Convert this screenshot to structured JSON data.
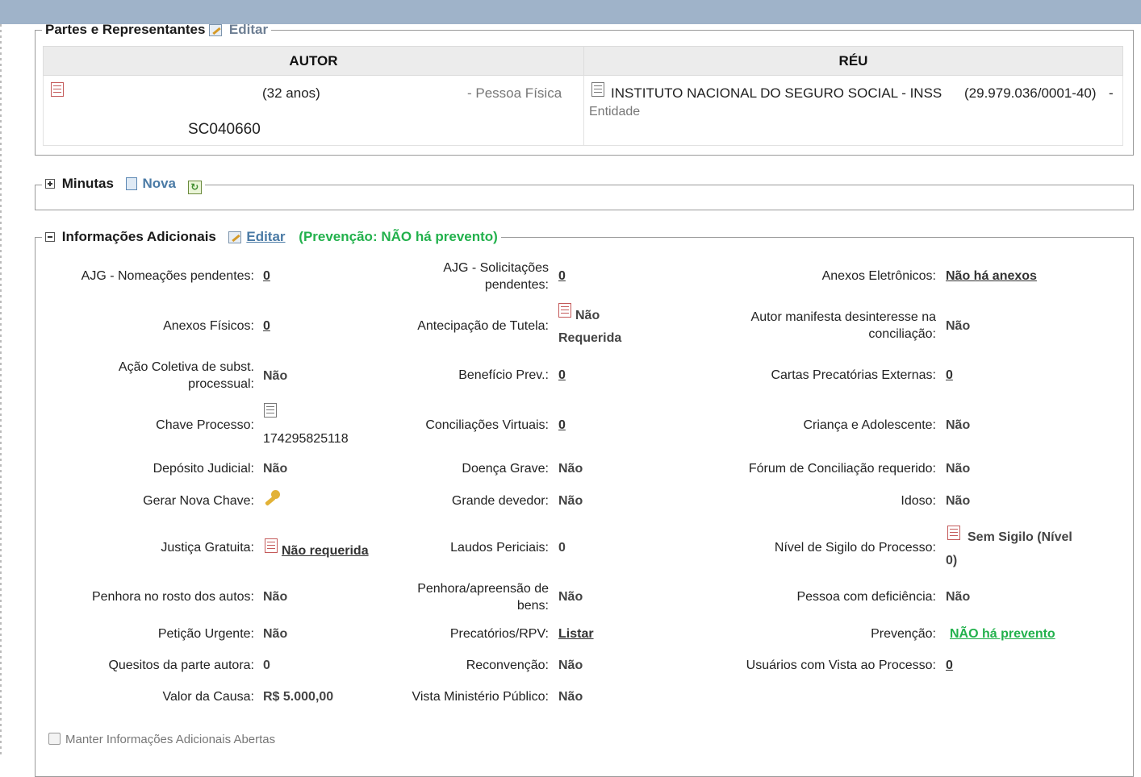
{
  "partes": {
    "legend": "Partes e Representantes",
    "edit_label": "Editar",
    "col_autor": "AUTOR",
    "col_reu": "RÉU",
    "autor": {
      "age": "(32 anos)",
      "type": "- Pessoa Física",
      "oab": "SC040660"
    },
    "reu": {
      "name": "INSTITUTO NACIONAL DO SEGURO SOCIAL - INSS",
      "cnpj": "(29.979.036/0001-40)",
      "dash": "-",
      "type": "Entidade"
    }
  },
  "minutas": {
    "legend": "Minutas",
    "new_label": "Nova"
  },
  "info": {
    "legend": "Informações Adicionais",
    "edit_label": "Editar",
    "prevencao_note": "(Prevenção:  NÃO há prevento)",
    "fields": {
      "ajg_nomeacoes": {
        "label": "AJG - Nomeações pendentes:",
        "value": "0"
      },
      "ajg_solicitacoes": {
        "label1": "AJG - Solicitações",
        "label2": "pendentes:",
        "value": "0"
      },
      "anexos_eletronicos": {
        "label": "Anexos Eletrônicos:",
        "value": "Não há anexos"
      },
      "anexos_fisicos": {
        "label": "Anexos Físicos:",
        "value": "0"
      },
      "antecipacao": {
        "label": "Antecipação de Tutela:",
        "value1": "Não",
        "value2": "Requerida"
      },
      "autor_desinteresse": {
        "label1": "Autor manifesta desinteresse na",
        "label2": "conciliação:",
        "value": "Não"
      },
      "acao_coletiva": {
        "label1": "Ação Coletiva de subst.",
        "label2": "processual:",
        "value": "Não"
      },
      "beneficio": {
        "label": "Benefício Prev.:",
        "value": "0"
      },
      "cartas": {
        "label": "Cartas Precatórias Externas:",
        "value": "0"
      },
      "chave": {
        "label": "Chave Processo:",
        "value": "174295825118"
      },
      "conciliacoes": {
        "label": "Conciliações Virtuais:",
        "value": "0"
      },
      "crianca": {
        "label": "Criança e Adolescente:",
        "value": "Não"
      },
      "deposito": {
        "label": "Depósito Judicial:",
        "value": "Não"
      },
      "doenca": {
        "label": "Doença Grave:",
        "value": "Não"
      },
      "forum": {
        "label": "Fórum de Conciliação requerido:",
        "value": "Não"
      },
      "gerar_chave": {
        "label": "Gerar Nova Chave:"
      },
      "grande_devedor": {
        "label": "Grande devedor:",
        "value": "Não"
      },
      "idoso": {
        "label": "Idoso:",
        "value": "Não"
      },
      "justica": {
        "label": "Justiça Gratuita:",
        "value": "Não requerida"
      },
      "laudos": {
        "label": "Laudos Periciais:",
        "value": "0"
      },
      "sigilo": {
        "label": "Nível de Sigilo do Processo:",
        "value1": "Sem Sigilo (Nível",
        "value2": "0)"
      },
      "penhora_rosto": {
        "label": "Penhora no rosto dos autos:",
        "value": "Não"
      },
      "penhora_apreensao": {
        "label1": "Penhora/apreensão de",
        "label2": "bens:",
        "value": "Não"
      },
      "deficiencia": {
        "label": "Pessoa com deficiência:",
        "value": "Não"
      },
      "peticao": {
        "label": "Petição Urgente:",
        "value": "Não"
      },
      "precatorios": {
        "label": "Precatórios/RPV:",
        "value": "Listar"
      },
      "prevencao": {
        "label": "Prevenção:",
        "value": "NÃO há prevento"
      },
      "quesitos": {
        "label": "Quesitos da parte autora:",
        "value": "0"
      },
      "reconvencao": {
        "label": "Reconvenção:",
        "value": "Não"
      },
      "usuarios_vista": {
        "label": "Usuários com Vista ao Processo:",
        "value": "0"
      },
      "valor_causa": {
        "label": "Valor da Causa:",
        "value": "R$ 5.000,00"
      },
      "vista_mp": {
        "label": "Vista Ministério Público:",
        "value": "Não"
      }
    },
    "keep_open_label": "Manter Informações Adicionais Abertas"
  },
  "colors": {
    "accent_green": "#22b14c",
    "link_blue": "#4b7ba6",
    "topbar": "#9fb3c9"
  }
}
